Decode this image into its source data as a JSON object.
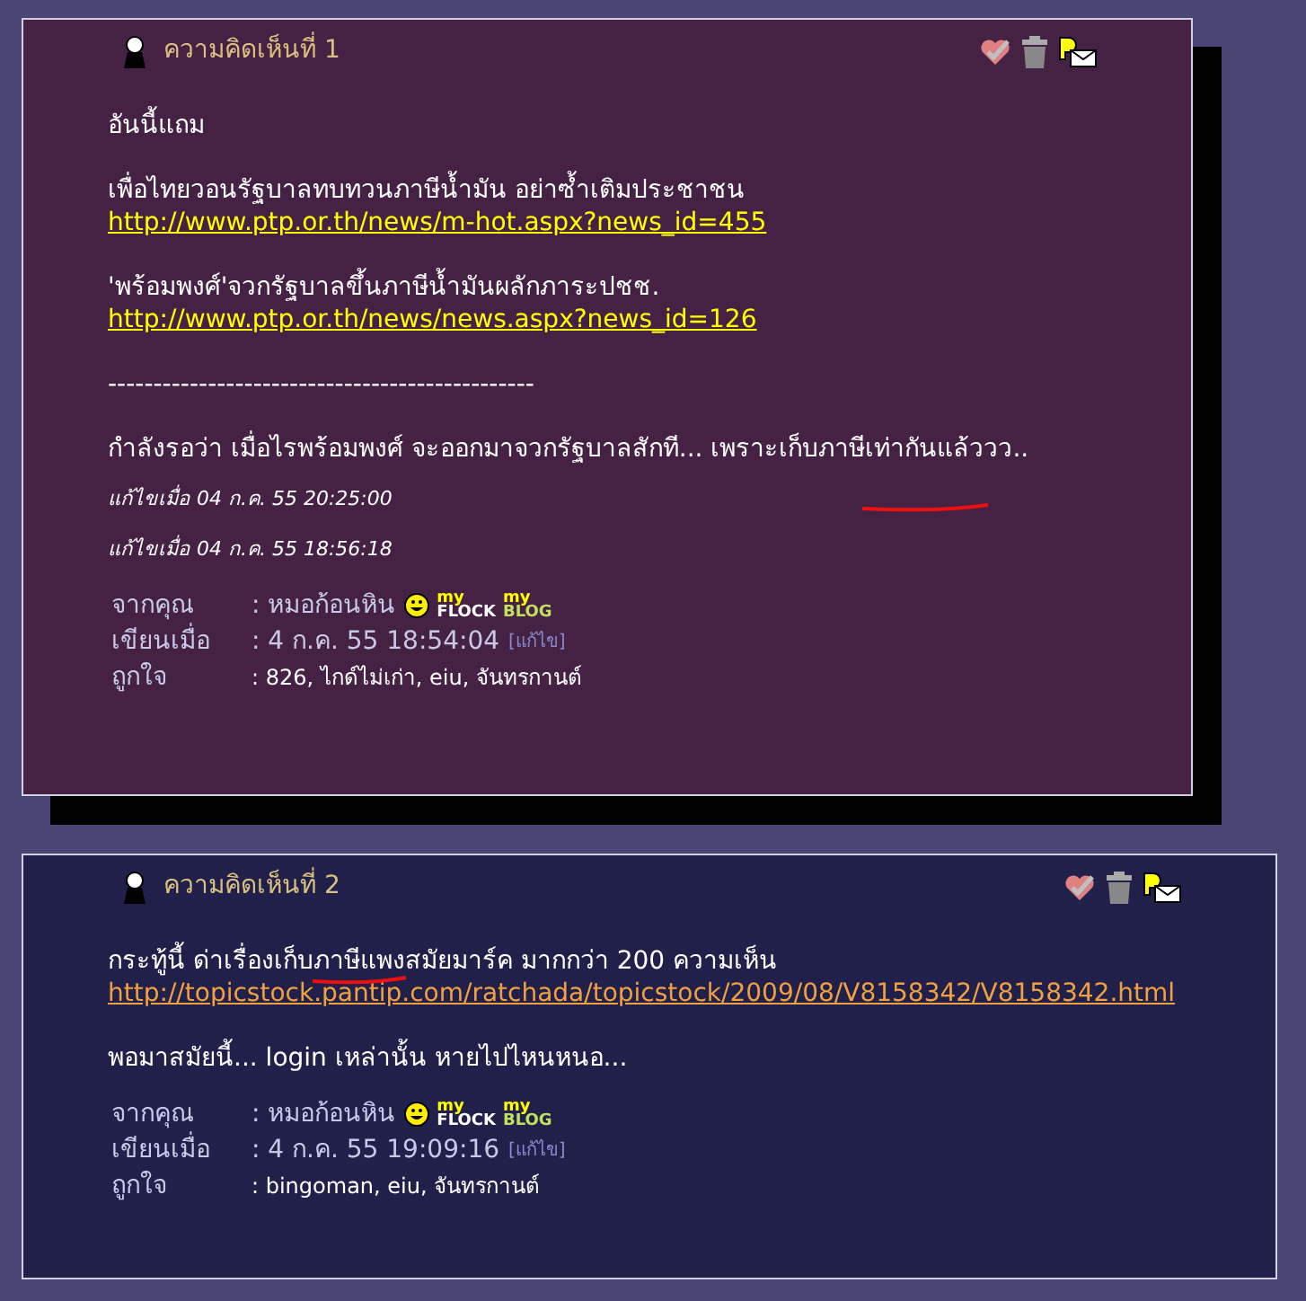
{
  "comments": [
    {
      "color": "#452244",
      "shadow": true,
      "title": "ความคิดเห็นที่ 1",
      "body": [
        {
          "kind": "text",
          "text": "อันนี้แถม"
        },
        {
          "kind": "gap"
        },
        {
          "kind": "text",
          "text": "เพื่อไทยวอนรัฐบาลทบทวนภาษีน้ำมัน อย่าซ้ำเติมประชาชน"
        },
        {
          "kind": "link",
          "color": "#ffff00",
          "text": "http://www.ptp.or.th/news/m-hot.aspx?news_id=455"
        },
        {
          "kind": "gap"
        },
        {
          "kind": "text",
          "text": "'พร้อมพงศ์'จวกรัฐบาลขึ้นภาษีน้ำมันผลักภาระปชช."
        },
        {
          "kind": "link",
          "color": "#ffff00",
          "text": "http://www.ptp.or.th/news/news.aspx?news_id=126"
        },
        {
          "kind": "gap"
        },
        {
          "kind": "text",
          "text": "-----------------------------------------------"
        },
        {
          "kind": "gap"
        },
        {
          "kind": "text",
          "text": "กำลังรอว่า เมื่อไรพร้อมพงศ์ จะออกมาจวกรัฐบาลสักที... เพราะเก็บภาษีเท่ากันแล้ววว.."
        },
        {
          "kind": "note",
          "text": "แก้ไขเมื่อ 04 ก.ค. 55 20:25:00"
        },
        {
          "kind": "note",
          "text": "แก้ไขเมื่อ 04 ก.ค. 55 18:56:18"
        }
      ],
      "meta": [
        {
          "kind": "author",
          "label": "จากคุณ",
          "value": ": หมอก้อนหิน",
          "badges": [
            "my",
            "FLOCK",
            "my",
            "BLOG"
          ]
        },
        {
          "kind": "date",
          "label": "เขียนเมื่อ",
          "value": ": 4 ก.ค. 55 18:54:04",
          "edit": "[แก้ไข]"
        },
        {
          "kind": "likes",
          "label": "ถูกใจ",
          "value": ": 826, ไกด์ไม่เก่า, eiu, จันทรกานต์"
        }
      ]
    },
    {
      "color": "#20204a",
      "shadow": false,
      "title": "ความคิดเห็นที่ 2",
      "body": [
        {
          "kind": "text",
          "text": "กระทู้นี้ ด่าเรื่องเก็บภาษีแพงสมัยมาร์ค มากกว่า 200 ความเห็น"
        },
        {
          "kind": "link",
          "color": "#f0a040",
          "text": "http://topicstock.pantip.com/ratchada/topicstock/2009/08/V8158342/V8158342.html"
        },
        {
          "kind": "gap"
        },
        {
          "kind": "text",
          "text": "พอมาสมัยนี้... login เหล่านั้น หายไปไหนหนอ..."
        }
      ],
      "meta": [
        {
          "kind": "author",
          "label": "จากคุณ",
          "value": ": หมอก้อนหิน",
          "badges": [
            "my",
            "FLOCK",
            "my",
            "BLOG"
          ]
        },
        {
          "kind": "date",
          "label": "เขียนเมื่อ",
          "value": ": 4 ก.ค. 55 19:09:16",
          "edit": "[แก้ไข]"
        },
        {
          "kind": "likes",
          "label": "ถูกใจ",
          "value": ": bingoman, eiu, จันทรกานต์"
        }
      ]
    }
  ]
}
